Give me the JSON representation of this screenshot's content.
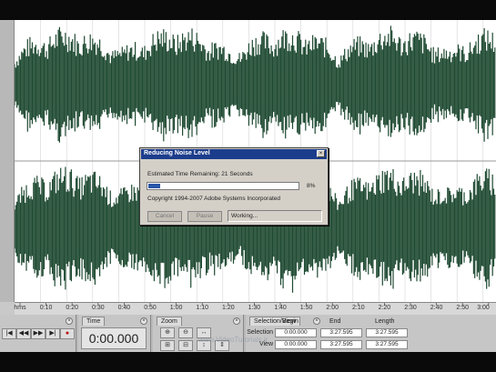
{
  "dialog": {
    "title": "Reducing Noise Level",
    "close_glyph": "×",
    "estimated_time": "Estimated Time Remaining: 21 Seconds",
    "progress_percent": 8,
    "progress_label": "8%",
    "copyright": "Copyright 1994-2007 Adobe Systems Incorporated",
    "cancel_label": "Cancel",
    "pause_label": "Pause",
    "status": "Working..."
  },
  "ruler": {
    "ticks": [
      "hms",
      "0:10",
      "0:20",
      "0:30",
      "0:40",
      "0:50",
      "1:00",
      "1:10",
      "1:20",
      "1:30",
      "1:40",
      "1:50",
      "2:00",
      "2:10",
      "2:20",
      "2:30",
      "2:40",
      "2:50",
      "3:00"
    ]
  },
  "transport": {
    "buttons": [
      {
        "icon": "rewind-to-start-icon",
        "glyph": "|◀"
      },
      {
        "icon": "rewind-icon",
        "glyph": "◀◀"
      },
      {
        "icon": "fast-forward-icon",
        "glyph": "▶▶"
      },
      {
        "icon": "forward-to-end-icon",
        "glyph": "▶|"
      },
      {
        "icon": "record-icon",
        "glyph": "●"
      }
    ]
  },
  "time_panel": {
    "tab_label": "Time",
    "value": "0:00.000"
  },
  "zoom_panel": {
    "tab_label": "Zoom"
  },
  "selection_panel": {
    "tab_label": "Selection/View",
    "headers": {
      "begin": "Begin",
      "end": "End",
      "length": "Length"
    },
    "selection": {
      "label": "Selection",
      "begin": "0:00.000",
      "end": "3:27.595",
      "length": "3:27.595"
    },
    "view": {
      "label": "View",
      "begin": "0:00.000",
      "end": "3:27.595",
      "length": "3:27.595"
    }
  },
  "watermark": "www.VideoTutorials.ir",
  "colors": {
    "waveform": "#1f4a32",
    "progress": "#2a56a8",
    "titlebar": "#1c3d8c"
  }
}
